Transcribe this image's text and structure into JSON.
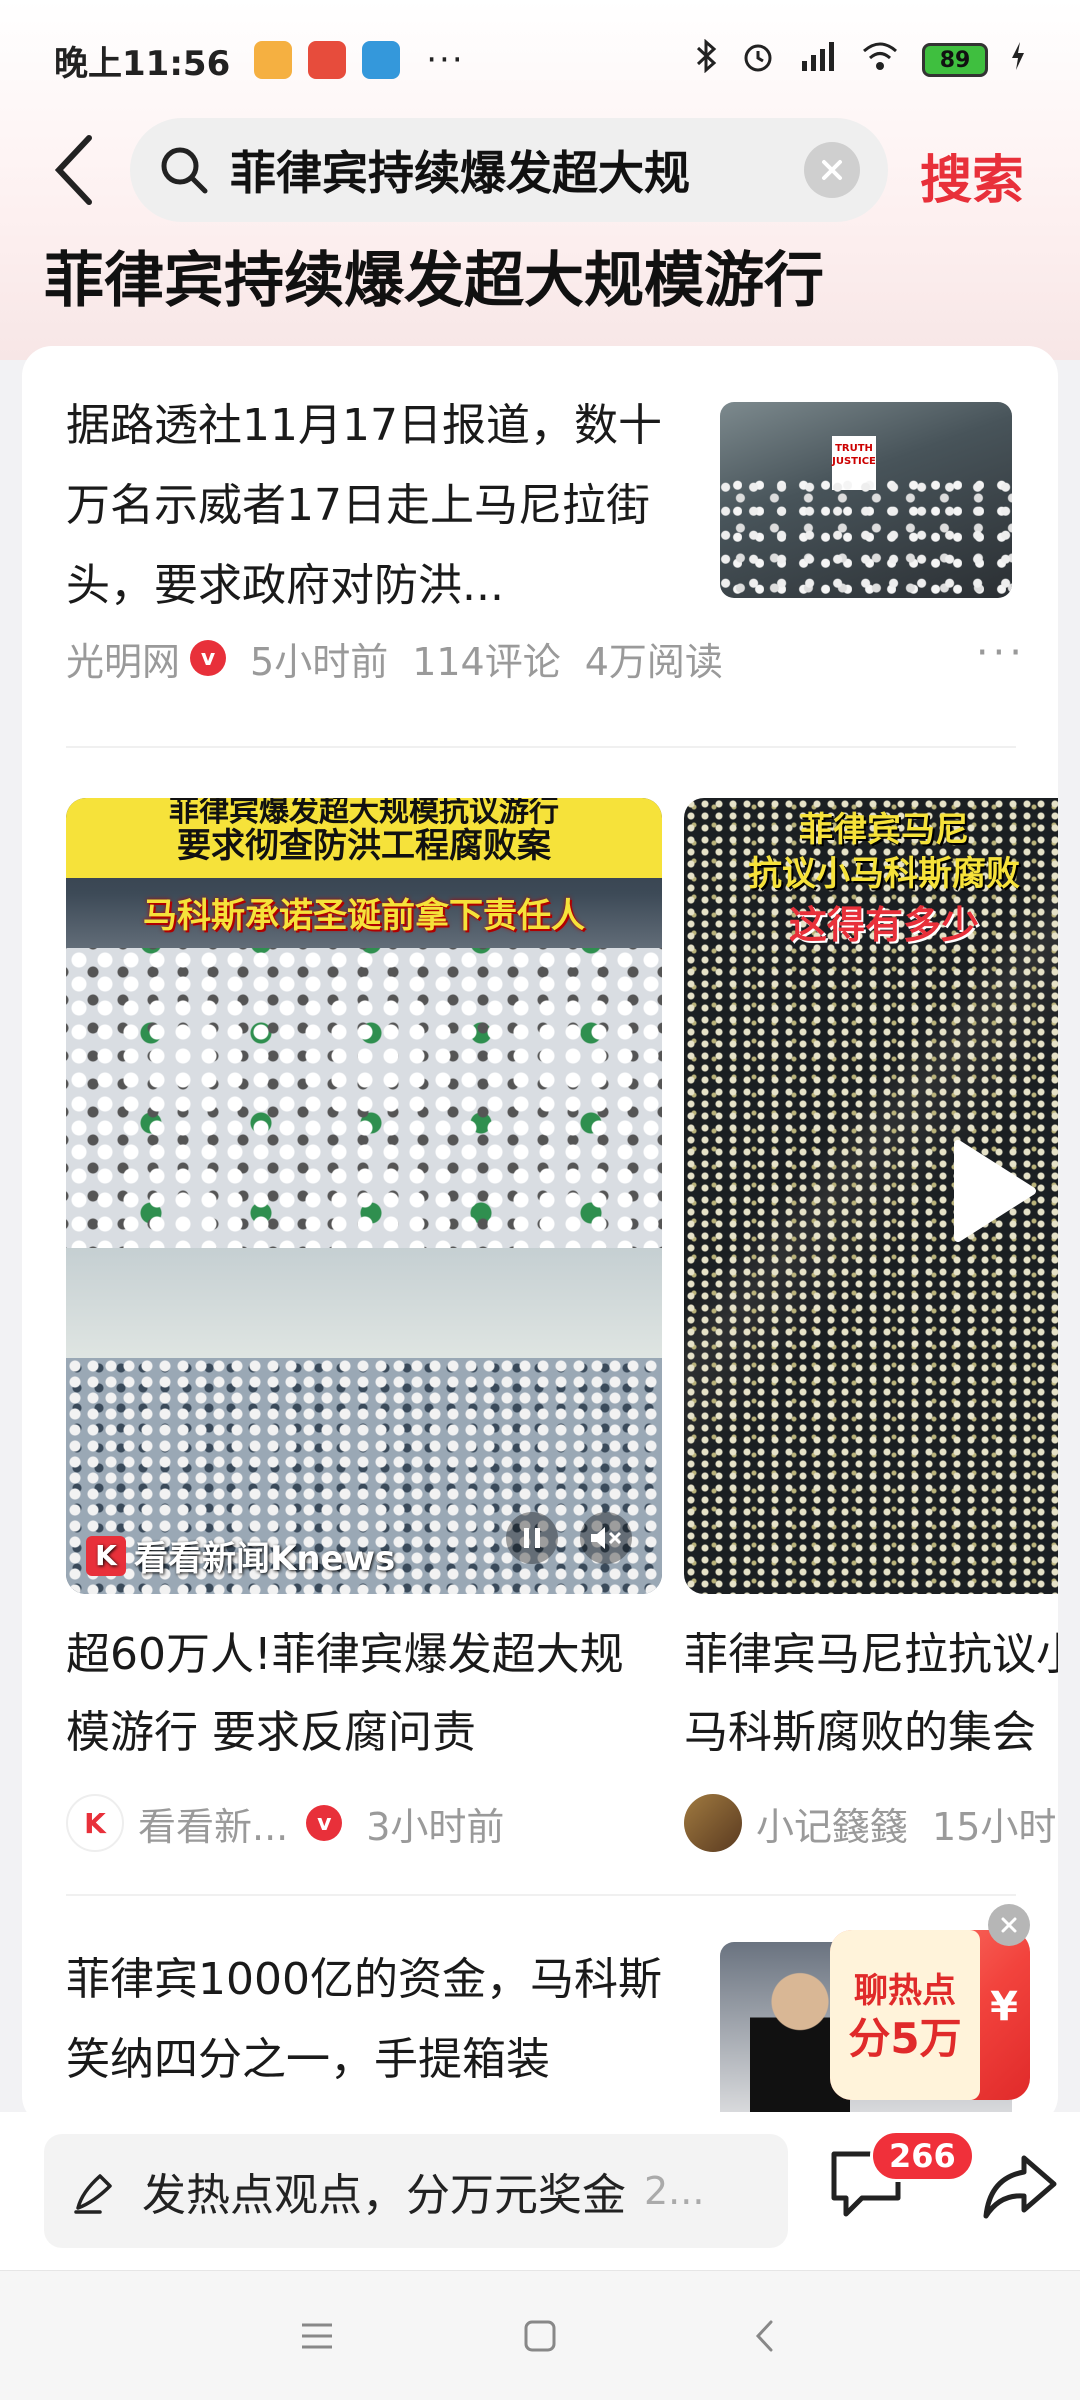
{
  "status_bar": {
    "time": "晚上11:56",
    "more": "···",
    "battery": "89"
  },
  "search": {
    "query": "菲律宾持续爆发超大规",
    "submit_label": "搜索"
  },
  "page": {
    "title": "菲律宾持续爆发超大规模游行"
  },
  "article_1": {
    "title": "据路透社11月17日报道，数十万名示威者17日走上马尼拉街头，要求政府对防洪...",
    "source": "光明网",
    "verified": "v",
    "time": "5小时前",
    "comments": "114评论",
    "reads": "4万阅读",
    "more": "···",
    "thumb_sign": "TRUTH JUSTICE"
  },
  "video_1": {
    "banner_line1": "菲律宾爆发超大规模抗议游行",
    "banner_line2": "要求彻查防洪工程腐败案",
    "subline": "马科斯承诺圣诞前拿下责任人",
    "watermark": "看看新闻Knews",
    "title": "超60万人!菲律宾爆发超大规模游行 要求反腐问责",
    "source": "看看新...",
    "verified": "v",
    "time": "3小时前"
  },
  "video_2": {
    "caption_1": "菲律宾马尼",
    "caption_2": "抗议小马科斯腐败",
    "caption_3": "这得有多少",
    "title": "菲律宾马尼拉抗议小马科斯腐败的集会",
    "source": "小记籛籛",
    "time": "15小时"
  },
  "article_3": {
    "title": "菲律宾1000亿的资金，马科斯笑纳四分之一，手提箱装"
  },
  "promo": {
    "line1": "聊热点",
    "line2": "分5万",
    "currency": "¥"
  },
  "comment_bar": {
    "placeholder": "发热点观点，分万元奖金",
    "suffix": "2...",
    "comment_count": "266"
  },
  "colors": {
    "accent": "#e8303a",
    "banner_yellow": "#f6e23a"
  }
}
